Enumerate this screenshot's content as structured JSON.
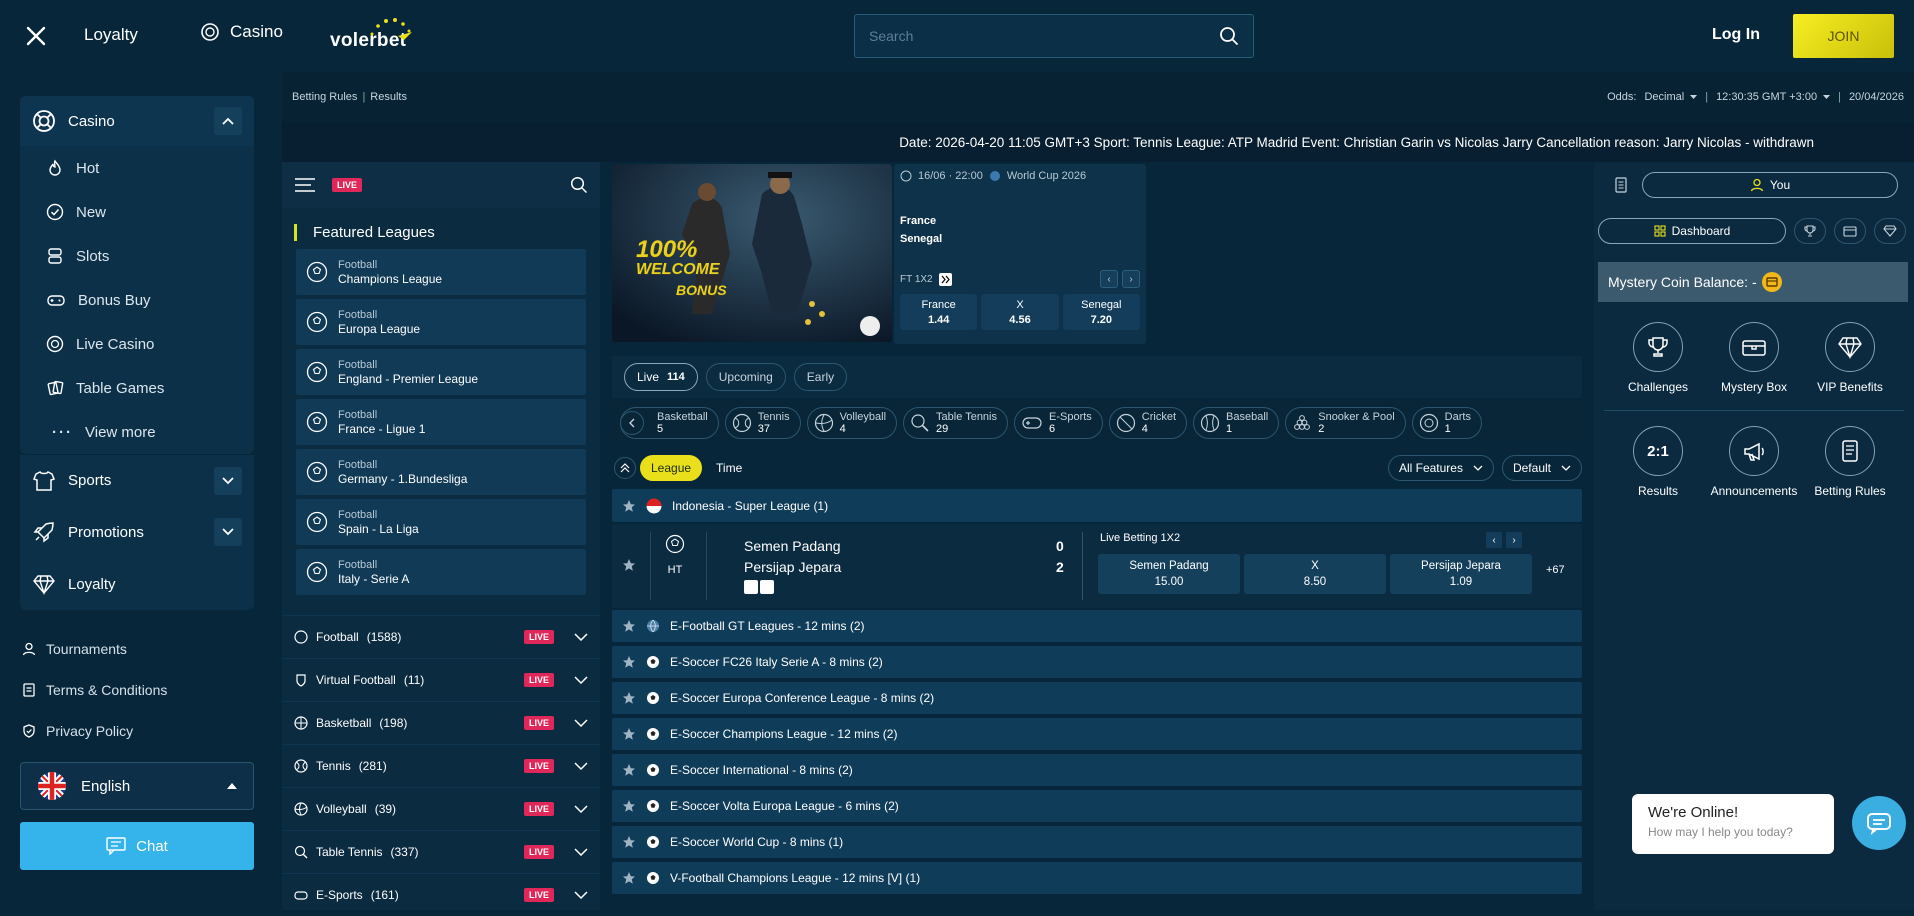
{
  "header": {
    "loyalty": "Loyalty",
    "casino": "Casino",
    "logo": "volerbet",
    "search_placeholder": "Search",
    "login": "Log In",
    "join": "JOIN"
  },
  "sidebar": {
    "casino_label": "Casino",
    "items": [
      {
        "label": "Hot",
        "icon": "flame-icon"
      },
      {
        "label": "New",
        "icon": "check-badge-icon"
      },
      {
        "label": "Slots",
        "icon": "slots-icon"
      },
      {
        "label": "Bonus Buy",
        "icon": "gamepad-icon"
      },
      {
        "label": "Live Casino",
        "icon": "chip-icon"
      },
      {
        "label": "Table Games",
        "icon": "cards-icon"
      }
    ],
    "view_more": "View more",
    "sports": "Sports",
    "promotions": "Promotions",
    "loyalty": "Loyalty",
    "misc": [
      "Tournaments",
      "Terms & Conditions",
      "Privacy Policy"
    ],
    "language": "English",
    "chat": "Chat"
  },
  "crumbs": {
    "betting_rules": "Betting Rules",
    "results": "Results",
    "odds_label": "Odds:",
    "odds_value": "Decimal",
    "time": "12:30:35 GMT +3:00",
    "date": "20/04/2026"
  },
  "ticker": "Date: 2026-04-20 11:05 GMT+3 Sport: Tennis League: ATP Madrid Event: Christian Garin vs Nicolas Jarry Cancellation reason: Jarry Nicolas - withdrawn",
  "leagues_col": {
    "live_badge": "LIVE",
    "featured_title": "Featured Leagues",
    "featured": [
      {
        "sport": "Football",
        "name": "Champions League"
      },
      {
        "sport": "Football",
        "name": "Europa League"
      },
      {
        "sport": "Football",
        "name": "England - Premier League"
      },
      {
        "sport": "Football",
        "name": "France - Ligue 1"
      },
      {
        "sport": "Football",
        "name": "Germany - 1.Bundesliga"
      },
      {
        "sport": "Football",
        "name": "Spain - La Liga"
      },
      {
        "sport": "Football",
        "name": "Italy - Serie A"
      }
    ],
    "sports": [
      {
        "name": "Football",
        "count": "(1588)"
      },
      {
        "name": "Virtual Football",
        "count": "(11)"
      },
      {
        "name": "Basketball",
        "count": "(198)"
      },
      {
        "name": "Tennis",
        "count": "(281)"
      },
      {
        "name": "Volleyball",
        "count": "(39)"
      },
      {
        "name": "Table Tennis",
        "count": "(337)"
      },
      {
        "name": "E-Sports",
        "count": "(161)"
      }
    ]
  },
  "banner": {
    "line1": "100%",
    "line2": "WELCOME",
    "line3": "BONUS"
  },
  "match_card": {
    "datetime": "16/06 · 22:00",
    "competition": "World Cup 2026",
    "home": "France",
    "away": "Senegal",
    "market": "FT 1X2",
    "odds": [
      {
        "label": "France",
        "value": "1.44"
      },
      {
        "label": "X",
        "value": "4.56"
      },
      {
        "label": "Senegal",
        "value": "7.20"
      }
    ]
  },
  "tabs": [
    {
      "label": "Live",
      "count": "114"
    },
    {
      "label": "Upcoming",
      "count": ""
    },
    {
      "label": "Early",
      "count": ""
    }
  ],
  "sports_bar": [
    {
      "name": "Basketball",
      "count": "5"
    },
    {
      "name": "Tennis",
      "count": "37"
    },
    {
      "name": "Volleyball",
      "count": "4"
    },
    {
      "name": "Table Tennis",
      "count": "29"
    },
    {
      "name": "E-Sports",
      "count": "6"
    },
    {
      "name": "Cricket",
      "count": "4"
    },
    {
      "name": "Baseball",
      "count": "1"
    },
    {
      "name": "Snooker & Pool",
      "count": "2"
    },
    {
      "name": "Darts",
      "count": "1"
    }
  ],
  "filters": {
    "league": "League",
    "time": "Time",
    "all_features": "All Features",
    "default": "Default"
  },
  "live_match": {
    "league": "Indonesia - Super League (1)",
    "status": "HT",
    "home": "Semen Padang",
    "away": "Persijap Jepara",
    "home_score": "0",
    "away_score": "2",
    "market": "Live Betting 1X2",
    "odds": [
      {
        "label": "Semen Padang",
        "value": "15.00"
      },
      {
        "label": "X",
        "value": "8.50"
      },
      {
        "label": "Persijap Jepara",
        "value": "1.09"
      }
    ],
    "more": "+67"
  },
  "league_rows": [
    "E-Football GT Leagues - 12 mins (2)",
    "E-Soccer FC26 Italy Serie A - 8 mins (2)",
    "E-Soccer Europa Conference League - 8 mins (2)",
    "E-Soccer Champions League - 12 mins (2)",
    "E-Soccer International - 8 mins (2)",
    "E-Soccer Volta Europa League - 6 mins (2)",
    "E-Soccer World Cup - 8 mins (1)",
    "V-Football Champions League - 12 mins [V] (1)"
  ],
  "right": {
    "you": "You",
    "dashboard": "Dashboard",
    "mystery": "Mystery Coin Balance: -",
    "grid": [
      "Challenges",
      "Mystery Box",
      "VIP Benefits",
      "Results",
      "Announcements",
      "Betting Rules"
    ]
  },
  "chat_popup": {
    "title": "We're Online!",
    "sub": "How may I help you today?"
  },
  "colors": {
    "bg": "#07263a",
    "accent_yellow": "#e9e01b",
    "live_red": "#e0275a",
    "chat_blue": "#34b4ea"
  }
}
